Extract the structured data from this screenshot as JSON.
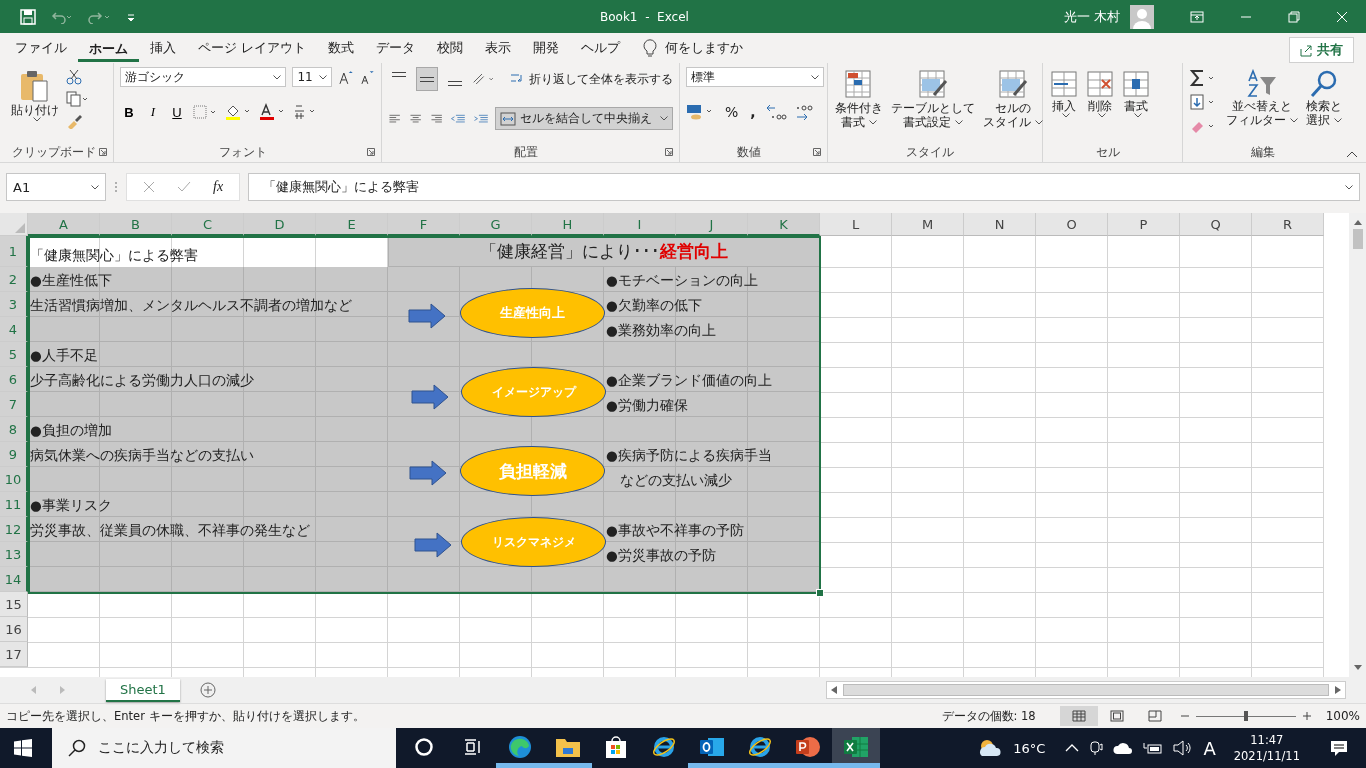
{
  "title_bar": {
    "title": "Book1  -  Excel",
    "user": "光一 木村"
  },
  "menu_tabs": [
    {
      "label": "ファイル",
      "selected": false
    },
    {
      "label": "ホーム",
      "selected": true
    },
    {
      "label": "挿入",
      "selected": false
    },
    {
      "label": "ページ レイアウト",
      "selected": false
    },
    {
      "label": "数式",
      "selected": false
    },
    {
      "label": "データ",
      "selected": false
    },
    {
      "label": "校閲",
      "selected": false
    },
    {
      "label": "表示",
      "selected": false
    },
    {
      "label": "開発",
      "selected": false
    },
    {
      "label": "ヘルプ",
      "selected": false
    }
  ],
  "tell_me": "何をしますか",
  "share_button": "共有",
  "ribbon": {
    "clipboard": {
      "paste": "貼り付け",
      "label": "クリップボード"
    },
    "font": {
      "name": "游ゴシック",
      "size": "11",
      "bold": "B",
      "italic": "I",
      "underline": "U",
      "label": "フォント"
    },
    "alignment": {
      "vertical": [
        {
          "selected": false
        },
        {
          "selected": true
        },
        {
          "selected": false
        }
      ],
      "wrap": "折り返して全体を表示する",
      "merge": {
        "label": "セルを結合して中央揃え",
        "selected": true
      },
      "label": "配置"
    },
    "number": {
      "format": "標準",
      "percent": "%",
      "comma": ",",
      "label": "数値"
    },
    "styles": {
      "buttons": [
        [
          "条件付き",
          "書式"
        ],
        [
          "テーブルとして",
          "書式設定"
        ],
        [
          "セルの",
          "スタイル"
        ]
      ],
      "label": "スタイル"
    },
    "cells": {
      "buttons": [
        "挿入",
        "削除",
        "書式"
      ],
      "label": "セル"
    },
    "editing": {
      "buttons": [
        [
          "並べ替えと",
          "フィルター"
        ],
        [
          "検索と",
          "選択"
        ]
      ],
      "label": "編集"
    }
  },
  "formula_bar": {
    "name_box": "A1",
    "fx": "fx",
    "formula": "「健康無関心」による弊害"
  },
  "sheet": {
    "columns": [
      {
        "label": "A",
        "selected": true
      },
      {
        "label": "B",
        "selected": true
      },
      {
        "label": "C",
        "selected": true
      },
      {
        "label": "D",
        "selected": true
      },
      {
        "label": "E",
        "selected": true
      },
      {
        "label": "F",
        "selected": true
      },
      {
        "label": "G",
        "selected": true
      },
      {
        "label": "H",
        "selected": true
      },
      {
        "label": "I",
        "selected": true
      },
      {
        "label": "J",
        "selected": true
      },
      {
        "label": "K",
        "selected": true
      },
      {
        "label": "L",
        "selected": false
      },
      {
        "label": "M",
        "selected": false
      },
      {
        "label": "N",
        "selected": false
      },
      {
        "label": "O",
        "selected": false
      },
      {
        "label": "P",
        "selected": false
      },
      {
        "label": "Q",
        "selected": false
      },
      {
        "label": "R",
        "selected": false
      }
    ],
    "rows": [
      {
        "label": "1",
        "selected": true
      },
      {
        "label": "2",
        "selected": true
      },
      {
        "label": "3",
        "selected": true
      },
      {
        "label": "4",
        "selected": true
      },
      {
        "label": "5",
        "selected": true
      },
      {
        "label": "6",
        "selected": true
      },
      {
        "label": "7",
        "selected": true
      },
      {
        "label": "8",
        "selected": true
      },
      {
        "label": "9",
        "selected": true
      },
      {
        "label": "10",
        "selected": true
      },
      {
        "label": "11",
        "selected": true
      },
      {
        "label": "12",
        "selected": true
      },
      {
        "label": "13",
        "selected": true
      },
      {
        "label": "14",
        "selected": true
      },
      {
        "label": "15",
        "selected": false
      },
      {
        "label": "16",
        "selected": false
      },
      {
        "label": "17",
        "selected": false
      }
    ],
    "heading": {
      "text": "「健康経営」により･･･",
      "highlight": "経営向上"
    },
    "row_texts": [
      {
        "left": "「健康無関心」による弊害"
      },
      {
        "left": "●生産性低下",
        "right": "●モチベーションの向上"
      },
      {
        "left": "生活習慣病増加、メンタルヘルス不調者の増加など",
        "right": "●欠勤率の低下"
      },
      {
        "right": "●業務効率の向上"
      },
      {
        "left": "●人手不足"
      },
      {
        "left": "少子高齢化による労働力人口の減少",
        "right": "●企業ブランド価値の向上"
      },
      {
        "right": "●労働力確保"
      },
      {
        "left": "●負担の増加"
      },
      {
        "left": "病気休業への疾病手当などの支払い",
        "right": "●疾病予防による疾病手当"
      },
      {
        "right": "　などの支払い減少"
      },
      {
        "left": "●事業リスク"
      },
      {
        "left": "労災事故、従業員の休職、不祥事の発生など",
        "right": "●事故や不祥事の予防"
      },
      {
        "right": "●労災事故の予防"
      }
    ],
    "benefits": [
      "生産性向上",
      "イメージアップ",
      "負担軽減",
      "リスクマネジメ"
    ]
  },
  "sheet_tabs": [
    {
      "label": "Sheet1",
      "selected": true
    }
  ],
  "status_bar": {
    "message": "コピー先を選択し、Enter キーを押すか、貼り付けを選択します。",
    "count": "データの個数: 18",
    "views": [
      {
        "kind": "normal",
        "selected": true
      },
      {
        "kind": "layout",
        "selected": false
      },
      {
        "kind": "break",
        "selected": false
      }
    ],
    "zoom": {
      "level": 0.5
    },
    "zoom_text": "100%"
  },
  "taskbar": {
    "search_placeholder": "ここに入力して検索",
    "apps": [
      {
        "kind": "cortana",
        "running": false,
        "active": false
      },
      {
        "kind": "taskview",
        "running": false,
        "active": false
      },
      {
        "kind": "edge",
        "running": true,
        "active": false
      },
      {
        "kind": "folder",
        "running": true,
        "active": false
      },
      {
        "kind": "store",
        "running": false,
        "active": false
      },
      {
        "kind": "ie",
        "running": false,
        "active": false
      },
      {
        "kind": "outlook",
        "running": true,
        "active": false
      },
      {
        "kind": "ie",
        "running": true,
        "active": false
      },
      {
        "kind": "powerpoint",
        "running": true,
        "active": false
      },
      {
        "kind": "excel",
        "running": true,
        "active": true
      }
    ],
    "temperature": "16°C",
    "ime": "A",
    "time": "11:47",
    "date": "2021/11/11"
  }
}
